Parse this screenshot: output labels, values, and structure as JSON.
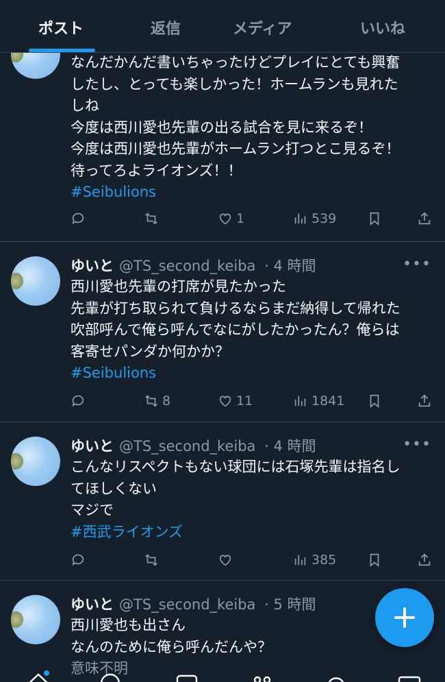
{
  "tabs": {
    "posts": "ポスト",
    "replies": "返信",
    "media": "メディア",
    "likes": "いいね"
  },
  "tweets": [
    {
      "name": "",
      "handle": "",
      "time": "",
      "lines": [
        "なんだかんだ書いちゃったけどプレイにとても興奮",
        "したし、とっても楽しかった！ホームランも見れた",
        "しね",
        "今度は西川愛也先輩の出る試合を見に来るぞ！",
        "今度は西川愛也先輩がホームラン打つとこ見るぞ！",
        "待ってろよライオンズ！！"
      ],
      "hashtag": "#Seibulions",
      "stats": {
        "reply": "",
        "retweet": "",
        "like": "1",
        "views": "539"
      }
    },
    {
      "name": "ゆいと",
      "handle": "@TS_second_keiba",
      "time": "· 4 時間",
      "lines": [
        "西川愛也先輩の打席が見たかった",
        "先輩が打ち取られて負けるならまだ納得して帰れた",
        "吹部呼んで俺ら呼んでなにがしたかったん？俺らは",
        "客寄せパンダか何かか？"
      ],
      "hashtag": "#Seibulions",
      "stats": {
        "reply": "",
        "retweet": "8",
        "like": "11",
        "views": "1841"
      }
    },
    {
      "name": "ゆいと",
      "handle": "@TS_second_keiba",
      "time": "· 4 時間",
      "lines": [
        "こんなリスペクトもない球団には石塚先輩は指名し",
        "てほしくない",
        "マジで"
      ],
      "hashtag": "#西武ライオンズ",
      "stats": {
        "reply": "",
        "retweet": "",
        "like": "",
        "views": "385"
      }
    },
    {
      "name": "ゆいと",
      "handle": "@TS_second_keiba",
      "time": "· 5 時間",
      "lines": [
        "西川愛也も出さん",
        "なんのために俺ら呼んだんや？",
        "意味不明"
      ]
    }
  ],
  "icons": {
    "reply": "reply-icon",
    "retweet": "retweet-icon",
    "like": "heart-icon",
    "views": "views-icon",
    "bookmark": "bookmark-icon",
    "share": "share-icon",
    "more": "more-icon",
    "compose": "plus-icon"
  },
  "more_glyph": "•••",
  "colors": {
    "background": "#15202b",
    "accent": "#1d9bf0",
    "text": "#f7f9f9",
    "muted": "#8b98a5",
    "divider": "#38444d"
  }
}
